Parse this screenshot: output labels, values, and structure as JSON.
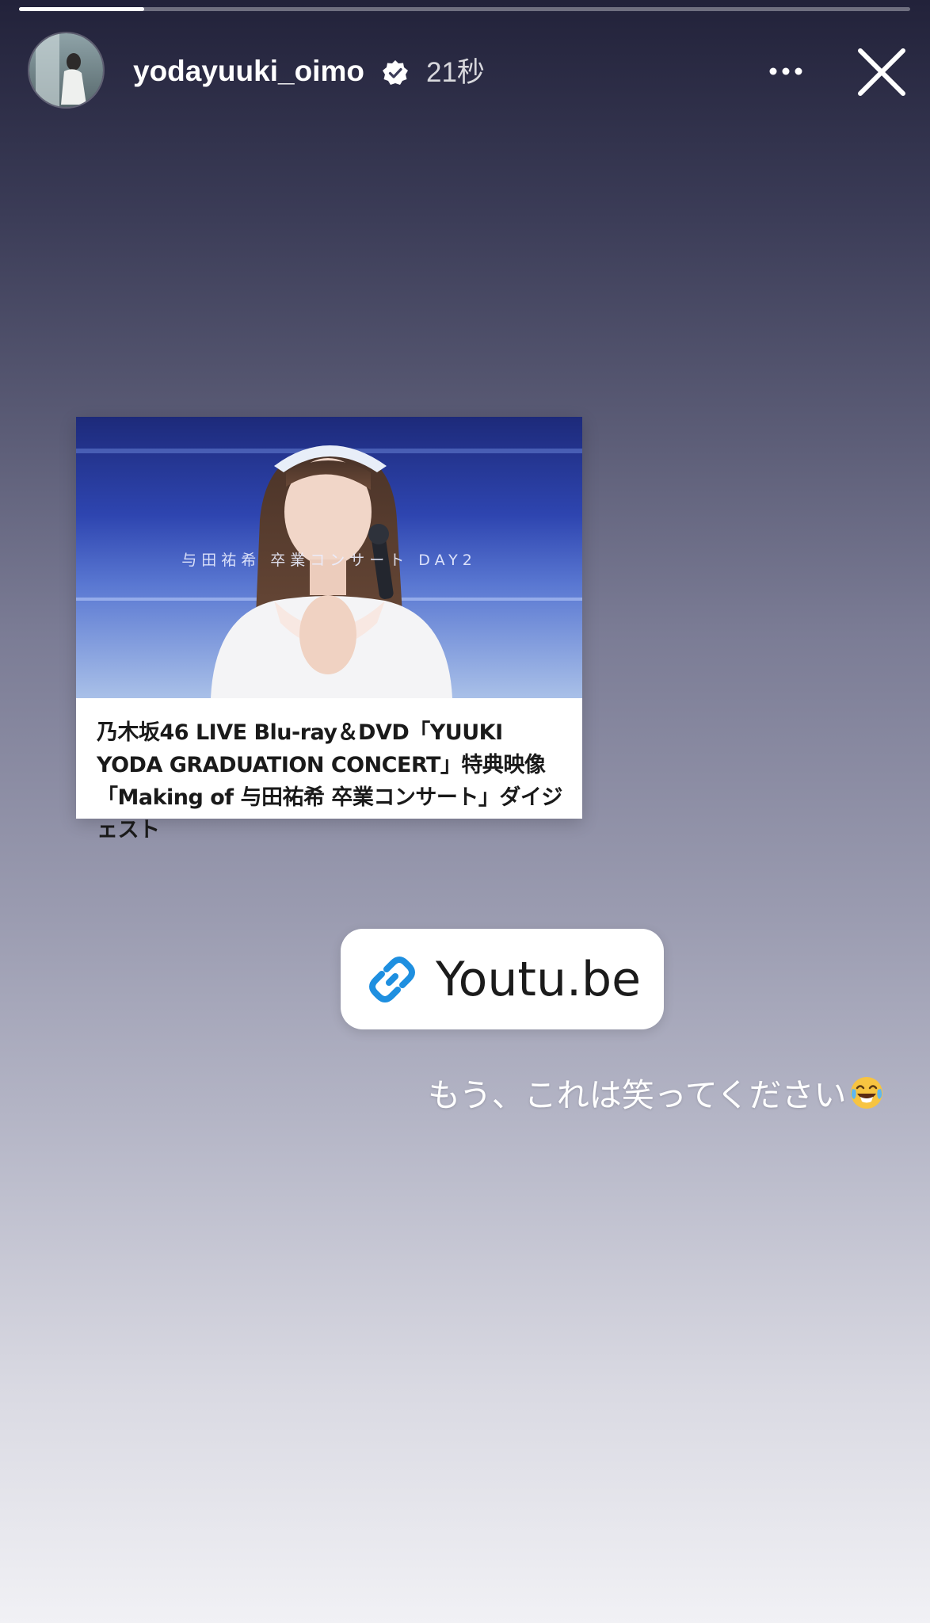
{
  "story": {
    "progress_fraction": 0.14
  },
  "header": {
    "username": "yodayuuki_oimo",
    "verified_icon": "verified-badge-icon",
    "timestamp": "21秒",
    "more_icon": "more-options-icon",
    "close_icon": "close-icon"
  },
  "youtube_card": {
    "thumbnail_overlay_text": "与田祐希 卒業コンサート DAY2",
    "title": "乃木坂46 LIVE Blu-ray＆DVD「YUUKI YODA GRADUATION CONCERT」特典映像「Making of 与田祐希 卒業コンサート」ダイジェスト"
  },
  "link_sticker": {
    "icon": "link-icon",
    "label": "Youtu.be",
    "accent_color": "#1e8fe0"
  },
  "caption": {
    "text": "もう、これは笑ってください",
    "emoji": "face-with-tears-of-joy-icon"
  }
}
